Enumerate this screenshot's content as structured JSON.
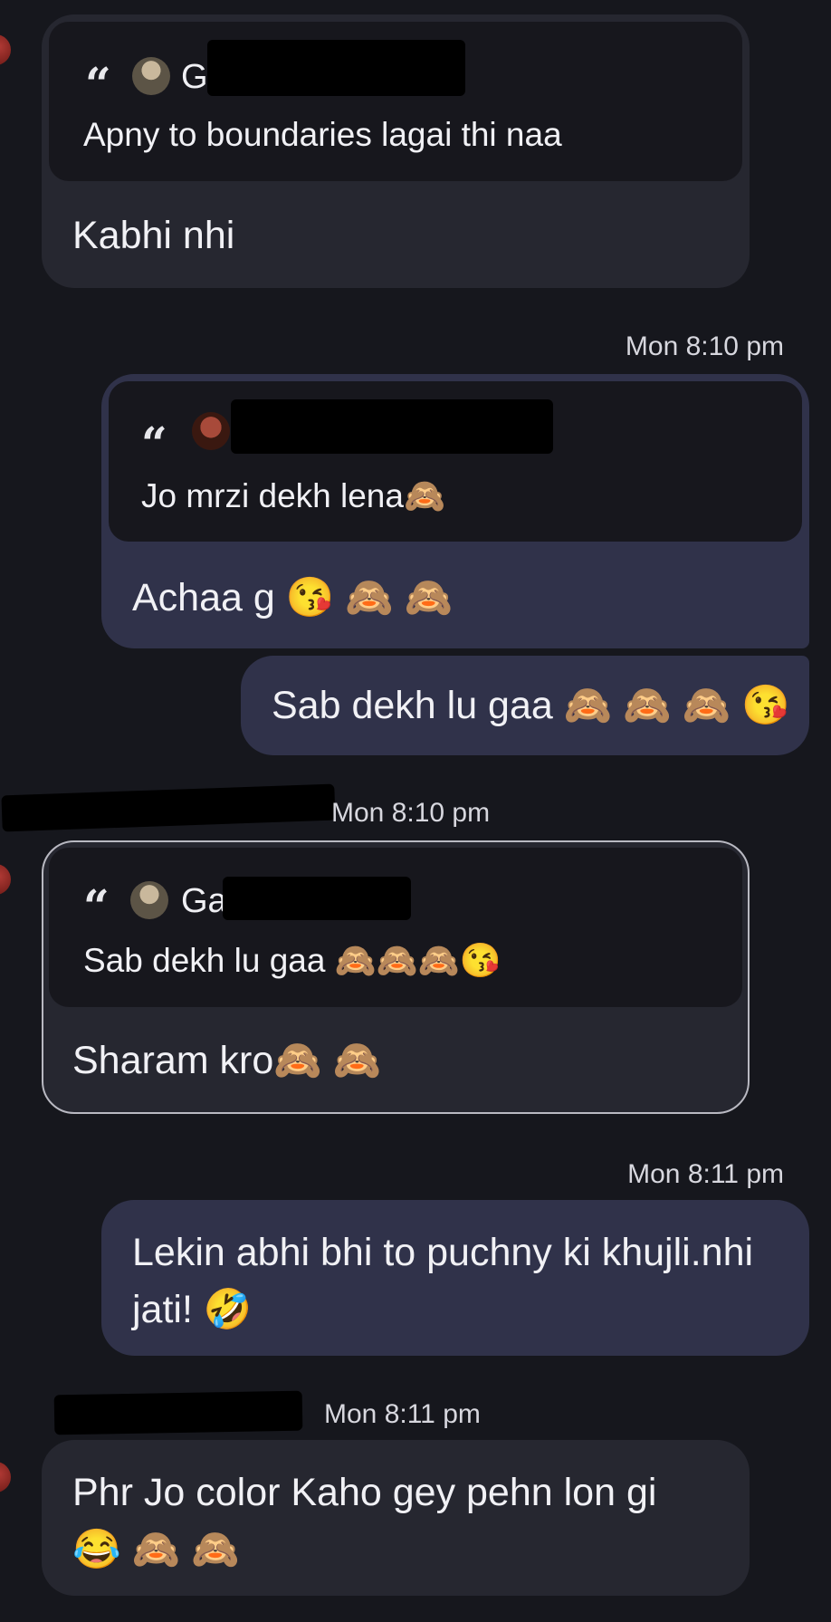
{
  "messages": [
    {
      "quote_name": "G",
      "quote_text": "Apny to boundaries lagai thi naa",
      "text": "Kabhi nhi"
    },
    {
      "timestamp": "Mon 8:10 pm",
      "quote_text": "Jo mrzi dekh lena🙈",
      "text": "Achaa g 😘 🙈 🙈"
    },
    {
      "text": "Sab dekh lu gaa 🙈 🙈 🙈 😘"
    },
    {
      "timestamp": "Mon 8:10 pm",
      "quote_name": "Ga",
      "quote_text": "Sab dekh lu gaa 🙈🙈🙈😘",
      "text": "Sharam kro🙈 🙈"
    },
    {
      "timestamp": "Mon 8:11 pm",
      "text_line1": "Lekin abhi bhi to puchny ki khujli.nhi",
      "text_line2": "jati! 🤣"
    },
    {
      "timestamp": "Mon 8:11 pm",
      "text_line1": "Phr Jo color Kaho gey pehn lon gi",
      "text_line2": "😂 🙈 🙈"
    }
  ],
  "icons": {
    "quote": "quote-icon",
    "avatar": "avatar"
  },
  "colors": {
    "background": "#16171d",
    "incoming_bubble": "#262730",
    "outgoing_bubble": "#30324a",
    "quote_box": "#17171d",
    "selected_border": "#b9b9c2"
  }
}
